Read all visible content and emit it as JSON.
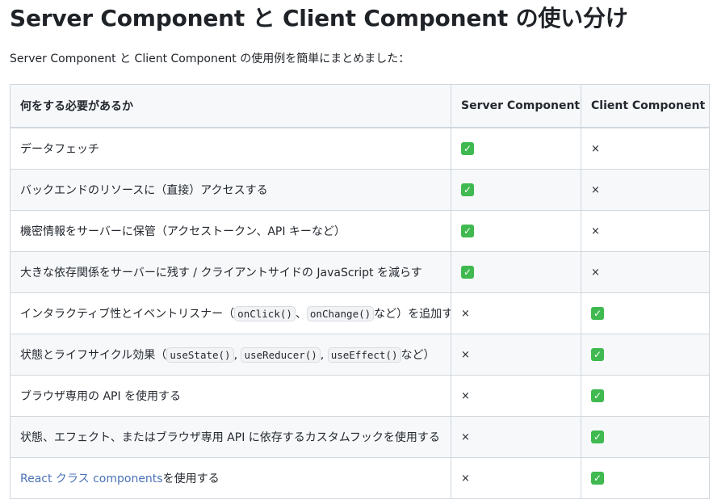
{
  "title": "Server Component と Client Component の使い分け",
  "intro": "Server Component と Client Component の使用例を簡単にまとめました：",
  "table": {
    "headers": [
      "何をする必要があるか",
      "Server Component",
      "Client Component"
    ],
    "check_symbol": "✓",
    "cross_symbol": "×",
    "rows": [
      {
        "text": "データフェッチ",
        "server": "check",
        "client": "cross"
      },
      {
        "text": "バックエンドのリソースに（直接）アクセスする",
        "server": "check",
        "client": "cross"
      },
      {
        "text": "機密情報をサーバーに保管（アクセストークン、API キーなど）",
        "server": "check",
        "client": "cross"
      },
      {
        "text": "大きな依存関係をサーバーに残す / クライアントサイドの JavaScript を減らす",
        "server": "check",
        "client": "cross"
      },
      {
        "text_before": "インタラクティブ性とイベントリスナー（",
        "code1": "onClick()",
        "sep1": "、",
        "code2": "onChange()",
        "text_after": "など）を追加する",
        "server": "cross",
        "client": "check"
      },
      {
        "text_before": "状態とライフサイクル効果（",
        "code1": "useState()",
        "sep1": ", ",
        "code2": "useReducer()",
        "sep2": ", ",
        "code3": "useEffect()",
        "text_after": "など）",
        "server": "cross",
        "client": "check"
      },
      {
        "text": "ブラウザ専用の API を使用する",
        "server": "cross",
        "client": "check"
      },
      {
        "text": "状態、エフェクト、またはブラウザ専用 API に依存するカスタムフックを使用する",
        "server": "cross",
        "client": "check"
      },
      {
        "link_text": "React クラス components",
        "text_after": "を使用する",
        "server": "cross",
        "client": "check"
      }
    ]
  },
  "colors": {
    "check_green": "#3fb950",
    "link_blue": "#4a72b8",
    "border": "#d0d7de",
    "header_bg": "#f6f8fa"
  }
}
